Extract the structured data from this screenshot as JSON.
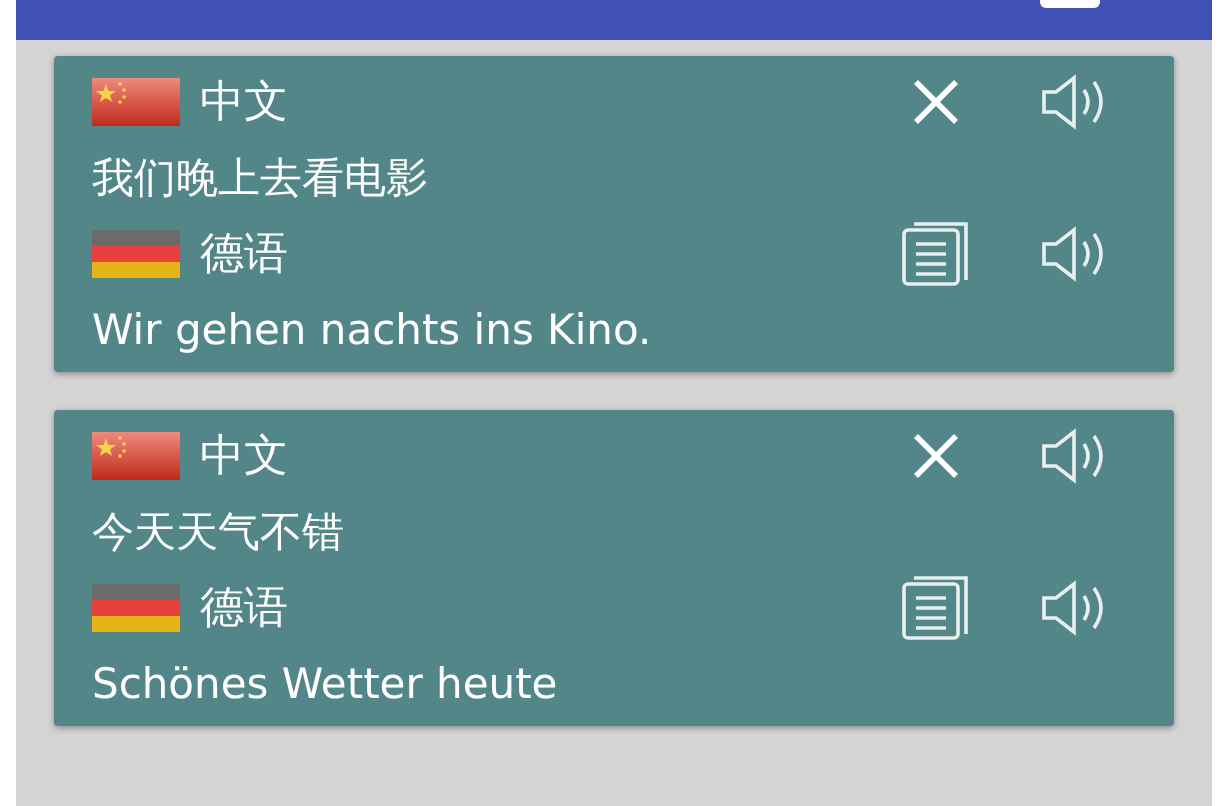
{
  "cards": [
    {
      "source": {
        "language": "中文",
        "text": "我们晚上去看电影"
      },
      "target": {
        "language": "德语",
        "text": "Wir gehen nachts ins Kino."
      }
    },
    {
      "source": {
        "language": "中文",
        "text": "今天天气不错"
      },
      "target": {
        "language": "德语",
        "text": "Schönes Wetter heute"
      }
    }
  ]
}
